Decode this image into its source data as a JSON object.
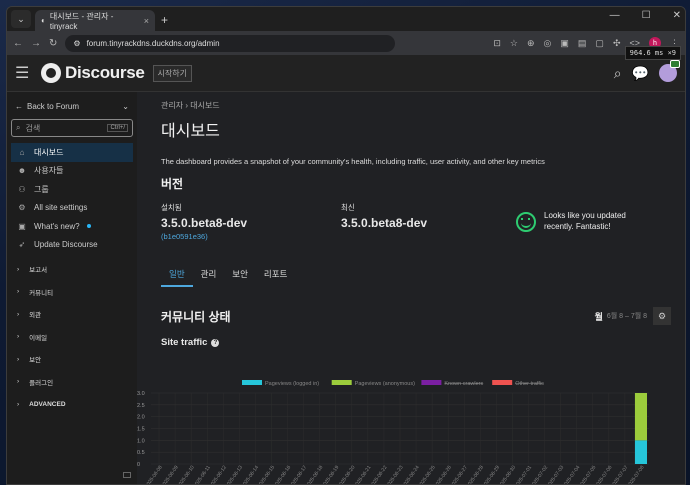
{
  "browser": {
    "tab_title": "대시보드 - 관리자 - tinyrack",
    "url": "forum.tinyrackdns.duckdns.org/admin",
    "profile_initial": "h"
  },
  "header": {
    "site_name": "Discourse",
    "start_label": "시작하기",
    "timing": "964.6 ms ×9"
  },
  "sidebar": {
    "back_label": "Back to Forum",
    "search_placeholder": "검색",
    "search_shortcut": "Ctrl+/",
    "items": [
      {
        "label": "대시보드",
        "icon": "home-icon"
      },
      {
        "label": "사용자들",
        "icon": "users-icon"
      },
      {
        "label": "그룹",
        "icon": "group-icon"
      },
      {
        "label": "All site settings",
        "icon": "gear-icon"
      },
      {
        "label": "What's new?",
        "icon": "gift-icon"
      },
      {
        "label": "Update Discourse",
        "icon": "rocket-icon"
      }
    ],
    "sections": [
      "보고서",
      "커뮤니티",
      "외관",
      "이메일",
      "보안",
      "플러그인",
      "ADVANCED"
    ]
  },
  "page": {
    "breadcrumb_root": "관리자",
    "breadcrumb_current": "대시보드",
    "title": "대시보드",
    "description": "The dashboard provides a snapshot of your community's health, including traffic, user activity, and other key metrics",
    "version_heading": "버전",
    "installed_label": "설치됨",
    "installed_version": "3.5.0.beta8-dev",
    "installed_hash": "(b1e0591e36)",
    "latest_label": "최신",
    "latest_version": "3.5.0.beta8-dev",
    "update_message": "Looks like you updated recently. Fantastic!",
    "tabs": [
      "일반",
      "관리",
      "보안",
      "리포트"
    ],
    "community_heading": "커뮤니티 상태",
    "period_label": "월",
    "period_range": "6월 8 – 7월 8",
    "site_traffic_title": "Site traffic"
  },
  "chart_data": {
    "type": "bar",
    "title": "Site traffic",
    "legend": [
      {
        "name": "Pageviews (logged in)",
        "color": "#26c6da",
        "hidden": false
      },
      {
        "name": "Pageviews (anonymous)",
        "color": "#9ccc3c",
        "hidden": false
      },
      {
        "name": "Known crawlers",
        "color": "#7b1fa2",
        "hidden": true
      },
      {
        "name": "Other traffic",
        "color": "#ef5350",
        "hidden": true
      }
    ],
    "categories": [
      "2025-06-08",
      "2025-06-09",
      "2025-06-10",
      "2025-06-11",
      "2025-06-12",
      "2025-06-13",
      "2025-06-14",
      "2025-06-15",
      "2025-06-16",
      "2025-06-17",
      "2025-06-18",
      "2025-06-19",
      "2025-06-20",
      "2025-06-21",
      "2025-06-22",
      "2025-06-23",
      "2025-06-24",
      "2025-06-25",
      "2025-06-26",
      "2025-06-27",
      "2025-06-28",
      "2025-06-29",
      "2025-06-30",
      "2025-07-01",
      "2025-07-02",
      "2025-07-03",
      "2025-07-04",
      "2025-07-05",
      "2025-07-06",
      "2025-07-07",
      "2025-07-08"
    ],
    "series": [
      {
        "name": "Pageviews (logged in)",
        "values": [
          0,
          0,
          0,
          0,
          0,
          0,
          0,
          0,
          0,
          0,
          0,
          0,
          0,
          0,
          0,
          0,
          0,
          0,
          0,
          0,
          0,
          0,
          0,
          0,
          0,
          0,
          0,
          0,
          0,
          0,
          1
        ]
      },
      {
        "name": "Pageviews (anonymous)",
        "values": [
          0,
          0,
          0,
          0,
          0,
          0,
          0,
          0,
          0,
          0,
          0,
          0,
          0,
          0,
          0,
          0,
          0,
          0,
          0,
          0,
          0,
          0,
          0,
          0,
          0,
          0,
          0,
          0,
          0,
          0,
          2
        ]
      }
    ],
    "yticks": [
      "0",
      "0.5",
      "1.0",
      "1.5",
      "2.0",
      "2.5",
      "3.0"
    ],
    "ylim": [
      0,
      3
    ],
    "stacked": true
  }
}
